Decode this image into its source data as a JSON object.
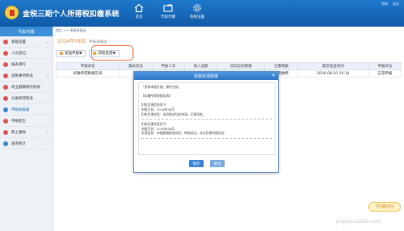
{
  "header": {
    "title": "金税三期个人所得税扣缴系统",
    "nav": [
      {
        "label": "首页",
        "icon": "home-icon"
      },
      {
        "label": "代扣代缴",
        "icon": "folder-icon"
      },
      {
        "label": "系统设置",
        "icon": "gear-icon"
      }
    ],
    "right": [
      "帮助",
      "退出"
    ]
  },
  "sidebar": {
    "head": "代扣代缴",
    "items": [
      {
        "label": "基础设置",
        "chevron": true
      },
      {
        "label": "人员登记",
        "chevron": false
      },
      {
        "label": "报表填写",
        "chevron": false
      },
      {
        "label": "减免事项附表",
        "chevron": true
      },
      {
        "label": "商业健康保险附表",
        "chevron": false
      },
      {
        "label": "分类所得附表",
        "chevron": false
      },
      {
        "label": "申报表报送",
        "chevron": false
      },
      {
        "label": "申报更正",
        "chevron": false
      },
      {
        "label": "网上缴款",
        "chevron": true
      },
      {
        "label": "查询统计",
        "chevron": true
      }
    ]
  },
  "main": {
    "breadcrumb": "首页 >> 申报表报送",
    "period": "2016年08月",
    "period_sub": "申报表报送",
    "toolbar": {
      "send_label": "发送申报▼",
      "feedback_label": "获取反馈▼"
    },
    "table": {
      "headers": [
        "申报表名",
        "报表状态",
        "申报人次",
        "收入总额",
        "实际应扣税额",
        "已缴税额",
        "最近发送时间",
        "申报状态"
      ],
      "rows": [
        [
          "扣缴所得税报告表",
          "",
          "",
          "",
          "",
          "无需缴费",
          "2016-08-10 10:34",
          "正常申报"
        ]
      ]
    }
  },
  "modal": {
    "title": "获取反馈结果",
    "close": "×",
    "lines": [
      "「获取申报反馈」操作完成。",
      "",
      "【扣缴所得税报告表】",
      "",
      "扣款反馈信息如下：",
      "申报月份：2016年08月",
      "扣款反馈信息：未扣款成功应申请，无需扣款。",
      "---",
      "扣款反馈信息如下：",
      "申报月份：2016年08月",
      "反馈信息：申报数据接收成功，审核成功。本次反馈申报状态：",
      "---"
    ],
    "ok_label": "保存",
    "cancel_label": "关闭"
  },
  "watermark": {
    "bubble": "学问题点乐",
    "site": "jingyan.baidu.com"
  }
}
